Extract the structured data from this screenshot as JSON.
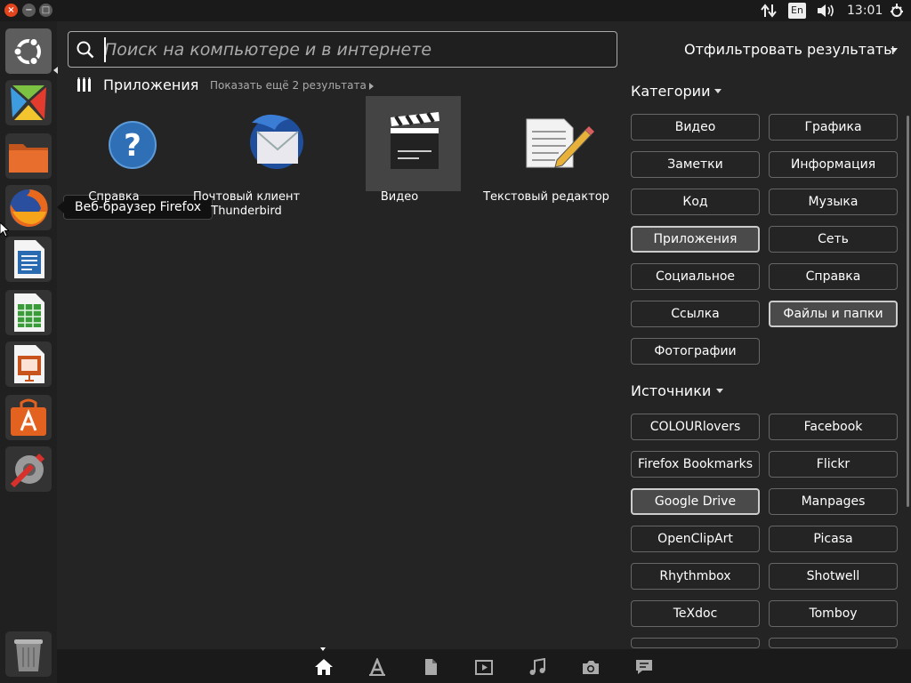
{
  "panel": {
    "close_glyph": "×",
    "min_glyph": "−",
    "max_glyph": "□",
    "keyboard_layout": "En",
    "clock": "13:01",
    "icons": [
      "network-arrows-icon",
      "keyboard-layout-icon",
      "volume-icon",
      "settings-gear-icon"
    ]
  },
  "launcher": {
    "items": [
      {
        "name": "ubuntu-dash-button",
        "icon": "ubuntu-logo-icon"
      },
      {
        "name": "launcher-crossover",
        "icon": "crossover-icon"
      },
      {
        "name": "launcher-files",
        "icon": "folder-icon"
      },
      {
        "name": "launcher-firefox",
        "icon": "firefox-icon"
      },
      {
        "name": "launcher-writer",
        "icon": "libreoffice-writer-icon"
      },
      {
        "name": "launcher-calc",
        "icon": "libreoffice-calc-icon"
      },
      {
        "name": "launcher-impress",
        "icon": "libreoffice-impress-icon"
      },
      {
        "name": "launcher-software-center",
        "icon": "software-center-icon"
      },
      {
        "name": "launcher-system-settings",
        "icon": "system-settings-icon"
      },
      {
        "name": "launcher-trash",
        "icon": "trash-icon"
      }
    ],
    "tooltip": "Веб-браузер Firefox"
  },
  "search": {
    "placeholder": "Поиск на компьютере и в интернете",
    "value": ""
  },
  "filter": {
    "header": "Отфильтровать результаты"
  },
  "results": {
    "category_title": "Приложения",
    "show_more": "Показать ещё 2 результата",
    "apps": [
      {
        "label": "Справка",
        "icon": "help-icon"
      },
      {
        "label": "Почтовый клиент Thunderbird",
        "icon": "thunderbird-icon"
      },
      {
        "label": "Видео",
        "icon": "video-clapper-icon"
      },
      {
        "label": "Текстовый редактор",
        "icon": "text-editor-icon"
      }
    ]
  },
  "categories": {
    "title": "Категории",
    "buttons": [
      "Видео",
      "Графика",
      "Заметки",
      "Информация",
      "Код",
      "Музыка",
      "Приложения",
      "Сеть",
      "Социальное",
      "Справка",
      "Ссылка",
      "Файлы и папки",
      "Фотографии"
    ],
    "active": [
      "Приложения",
      "Файлы и папки"
    ]
  },
  "sources": {
    "title": "Источники",
    "buttons": [
      "COLOURlovers",
      "Facebook",
      "Firefox Bookmarks",
      "Flickr",
      "Google Drive",
      "Manpages",
      "OpenClipArt",
      "Picasa",
      "Rhythmbox",
      "Shotwell",
      "TeXdoc",
      "Tomboy"
    ],
    "active": [
      "Google Drive"
    ]
  },
  "lenses": [
    "home-icon",
    "applications-icon",
    "files-icon",
    "video-icon",
    "music-icon",
    "photo-icon",
    "social-icon"
  ],
  "colors": {
    "accent": "#e3441d",
    "background": "#242424",
    "panel": "#1a1a1a"
  }
}
